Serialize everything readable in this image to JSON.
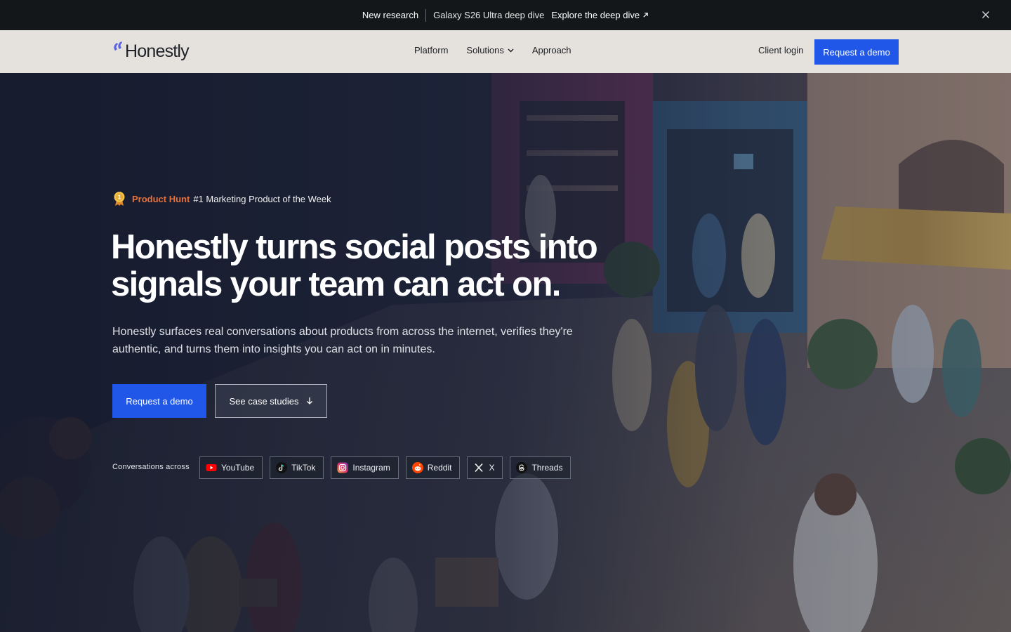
{
  "announcement": {
    "tag": "New research",
    "headline": "Galaxy S26 Ultra deep dive",
    "cta": "Explore the deep dive"
  },
  "nav": {
    "logo": "Honestly",
    "links": [
      {
        "label": "Platform"
      },
      {
        "label": "Solutions"
      },
      {
        "label": "Approach"
      }
    ],
    "login": "Client login",
    "demo": "Request a demo"
  },
  "hero": {
    "award_brand": "Product Hunt",
    "award_text": "#1 Marketing Product of the Week",
    "title": "Honestly turns social posts into signals your team can act on.",
    "subtitle": "Honestly surfaces real conversations about products from across the internet, verifies they're authentic, and turns them into insights you can act on in minutes.",
    "primary_cta": "Request a demo",
    "secondary_cta": "See case studies",
    "conversations_label": "Conversations across",
    "platforms": [
      {
        "label": "YouTube",
        "icon": "youtube-icon"
      },
      {
        "label": "TikTok",
        "icon": "tiktok-icon"
      },
      {
        "label": "Instagram",
        "icon": "instagram-icon"
      },
      {
        "label": "Reddit",
        "icon": "reddit-icon"
      },
      {
        "label": "X",
        "icon": "x-icon"
      },
      {
        "label": "Threads",
        "icon": "threads-icon"
      }
    ]
  },
  "colors": {
    "accent": "#2057e8",
    "product_hunt": "#e8713b",
    "announcement_bg": "#14171a",
    "nav_bg": "#e5e2de"
  }
}
